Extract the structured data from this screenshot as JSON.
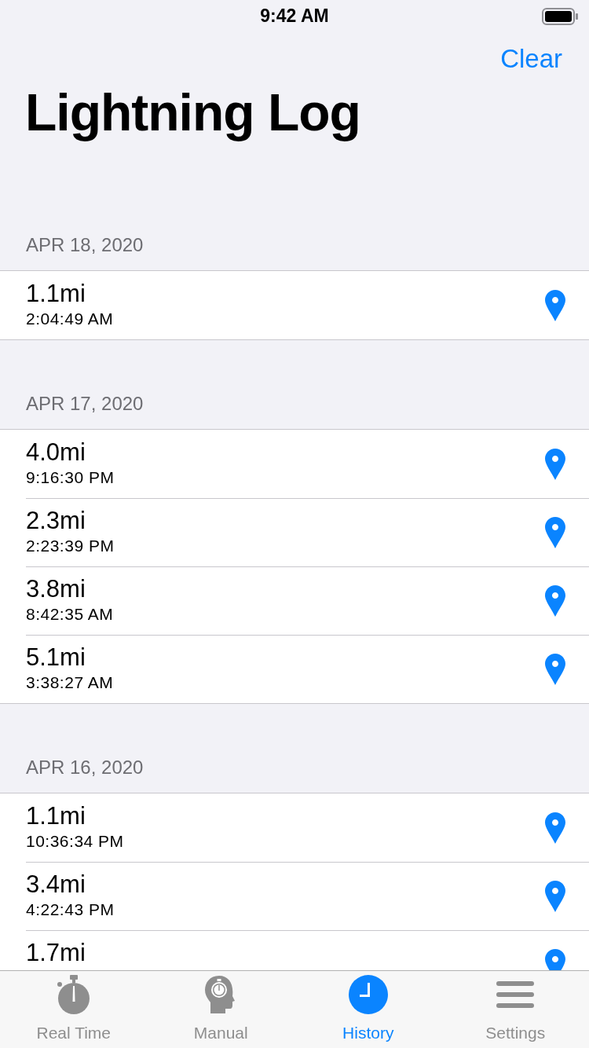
{
  "status_bar": {
    "time": "9:42 AM"
  },
  "nav": {
    "action": "Clear",
    "title": "Lightning Log"
  },
  "sections": [
    {
      "date": "APR 18, 2020",
      "rows": [
        {
          "distance": "1.1mi",
          "time": "2:04:49 AM"
        }
      ]
    },
    {
      "date": "APR 17, 2020",
      "rows": [
        {
          "distance": "4.0mi",
          "time": "9:16:30 PM"
        },
        {
          "distance": "2.3mi",
          "time": "2:23:39 PM"
        },
        {
          "distance": "3.8mi",
          "time": "8:42:35 AM"
        },
        {
          "distance": "5.1mi",
          "time": "3:38:27 AM"
        }
      ]
    },
    {
      "date": "APR 16, 2020",
      "rows": [
        {
          "distance": "1.1mi",
          "time": "10:36:34 PM"
        },
        {
          "distance": "3.4mi",
          "time": "4:22:43 PM"
        },
        {
          "distance": "1.7mi"
        }
      ]
    }
  ],
  "tabs": [
    {
      "kind": "stopwatch",
      "label": "Real Time",
      "selected": false
    },
    {
      "kind": "head",
      "label": "Manual",
      "selected": false
    },
    {
      "kind": "clock",
      "label": "History",
      "selected": true
    },
    {
      "kind": "lines",
      "label": "Settings",
      "selected": false
    }
  ]
}
